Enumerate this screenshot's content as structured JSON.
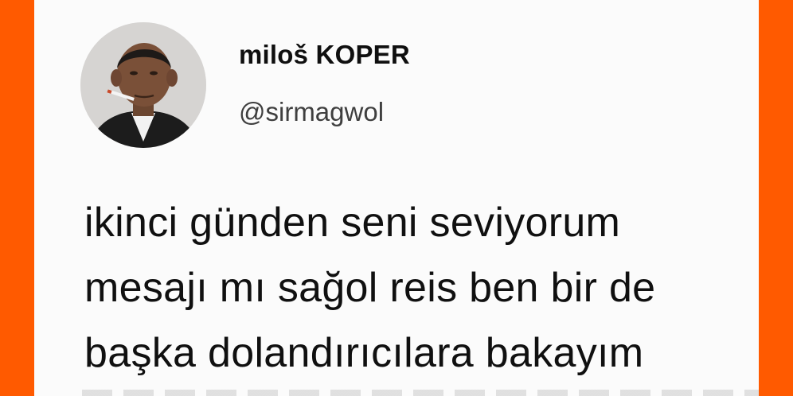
{
  "colors": {
    "border": "#ff5a00",
    "card_background": "#fbfbfb",
    "text": "#101010"
  },
  "tweet": {
    "author": {
      "display_name": "miloš KOPER",
      "handle": "@sirmagwol",
      "avatar_icon": "avatar-photo"
    },
    "text": "ikinci günden seni seviyorum\nmesajı mı sağol reis ben bir de\nbaşka dolandırıcılara bakayım"
  }
}
